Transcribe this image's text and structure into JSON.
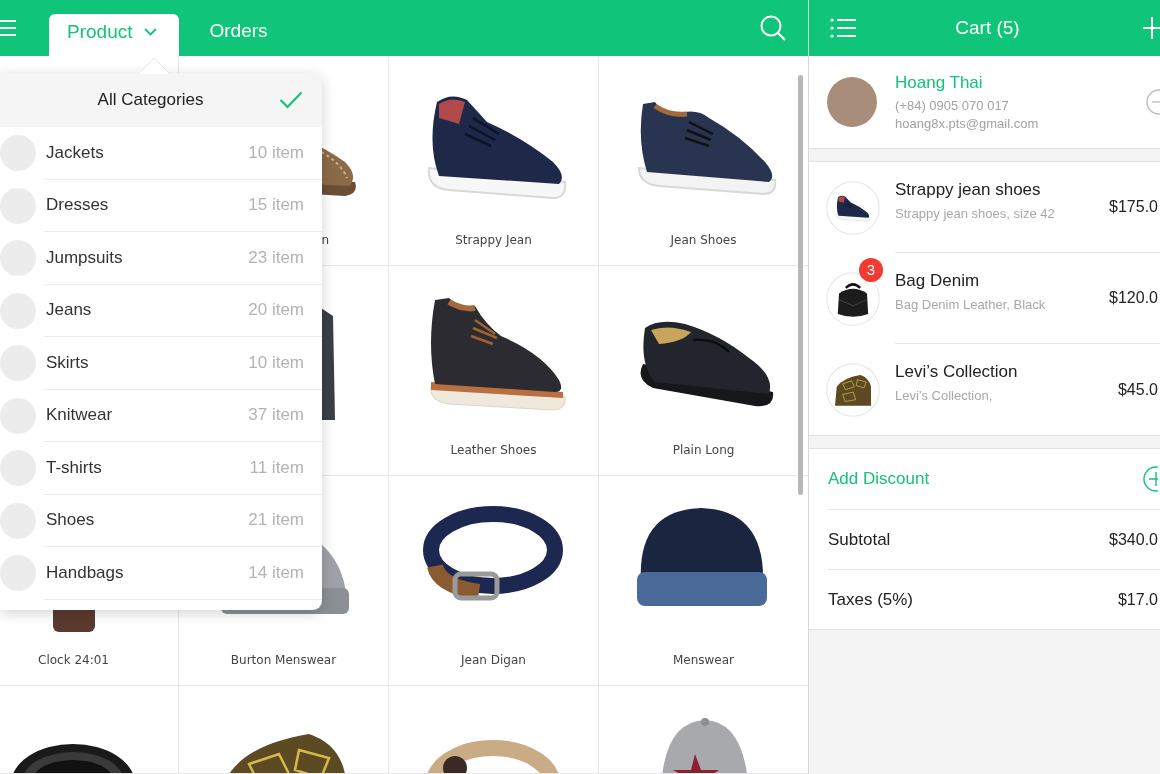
{
  "top_bar": {
    "tabs": [
      {
        "label": "Product",
        "selected": true,
        "expanded": true
      },
      {
        "label": "Orders",
        "selected": false,
        "expanded": false
      }
    ]
  },
  "category_menu": {
    "header": {
      "label": "All Categories",
      "selected": true
    },
    "items": [
      {
        "name": "Jackets",
        "count": "10 item",
        "selected": false
      },
      {
        "name": "Dresses",
        "count": "15 item",
        "selected": false
      },
      {
        "name": "Jumpsuits",
        "count": "23 item",
        "selected": false
      },
      {
        "name": "Jeans",
        "count": "20 item",
        "selected": false
      },
      {
        "name": "Skirts",
        "count": "10 item",
        "selected": false
      },
      {
        "name": "Knitwear",
        "count": "37 item",
        "selected": false
      },
      {
        "name": "T-shirts",
        "count": "11 item",
        "selected": false
      },
      {
        "name": "Shoes",
        "count": "21 item",
        "selected": false
      },
      {
        "name": "Handbags",
        "count": "14 item",
        "selected": false
      }
    ]
  },
  "product_grid": {
    "rows": [
      {
        "cells": [
          "",
          {
            "kind": "loafer",
            "label": "n",
            "label_clipped": true
          },
          {
            "kind": "sneaker",
            "label": "Strappy Jean"
          },
          {
            "kind": "oxford",
            "label": "Jean Shoes"
          }
        ]
      },
      {
        "cells": [
          "",
          {
            "kind": "jacket"
          },
          {
            "kind": "boot",
            "label": "Leather Shoes"
          },
          {
            "kind": "moccasin",
            "label": "Plain Long"
          }
        ]
      },
      {
        "cells": [
          {
            "kind": "watch",
            "label": "Clock 24:01"
          },
          {
            "kind": "hat",
            "label": "Burton Menswear"
          },
          {
            "kind": "belt",
            "label": "Jean Digan"
          },
          {
            "kind": "beanie",
            "label": "Menswear"
          }
        ]
      },
      {
        "cells": [
          {
            "kind": "coil"
          },
          {
            "kind": "tie"
          },
          {
            "kind": "strap"
          },
          {
            "kind": "cap"
          }
        ]
      }
    ]
  },
  "cart": {
    "title": "Cart (5)",
    "customer": {
      "name": "Hoang Thai",
      "phone": "(+84) 0905 070 017",
      "email": "hoang8x.pts@gmail.com"
    },
    "items": [
      {
        "kind": "sneaker",
        "name": "Strappy jean shoes",
        "detail": "Strappy jean shoes, size 42",
        "price": "$175.0"
      },
      {
        "kind": "bag",
        "name": "Bag Denim",
        "detail": "Bag Denim Leather, Black",
        "price": "$120.0",
        "badge": "3"
      },
      {
        "kind": "tie",
        "name": "Levi’s Collection",
        "detail": "Levi’s Collection,",
        "price": "$45.0"
      }
    ],
    "discount": {
      "label": "Add Discount"
    },
    "totals": [
      {
        "label": "Subtotal",
        "value": "$340.0"
      },
      {
        "label": "Taxes (5%)",
        "value": "$17.0"
      }
    ]
  }
}
